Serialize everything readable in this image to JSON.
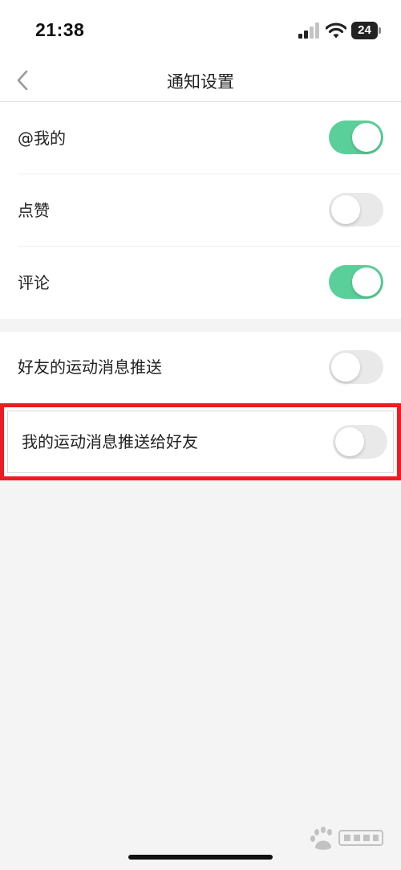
{
  "status_bar": {
    "time": "21:38",
    "battery": "24",
    "icons": [
      "signal-icon",
      "wifi-icon",
      "battery-icon"
    ]
  },
  "header": {
    "title": "通知设置",
    "back_icon": "chevron-left-icon"
  },
  "settings": [
    {
      "label": "@我的",
      "enabled": true
    },
    {
      "label": "点赞",
      "enabled": false
    },
    {
      "label": "评论",
      "enabled": true
    },
    {
      "label": "好友的运动消息推送",
      "enabled": false
    },
    {
      "label": "我的运动消息推送给好友",
      "enabled": false,
      "highlighted": true
    }
  ],
  "colors": {
    "toggle_on": "#5bcf9a",
    "toggle_off": "#e9e9ea",
    "highlight_border": "#ec1c24",
    "page_background": "#f4f4f4"
  },
  "watermark": {
    "logo": "baidu-jingyan-logo"
  }
}
